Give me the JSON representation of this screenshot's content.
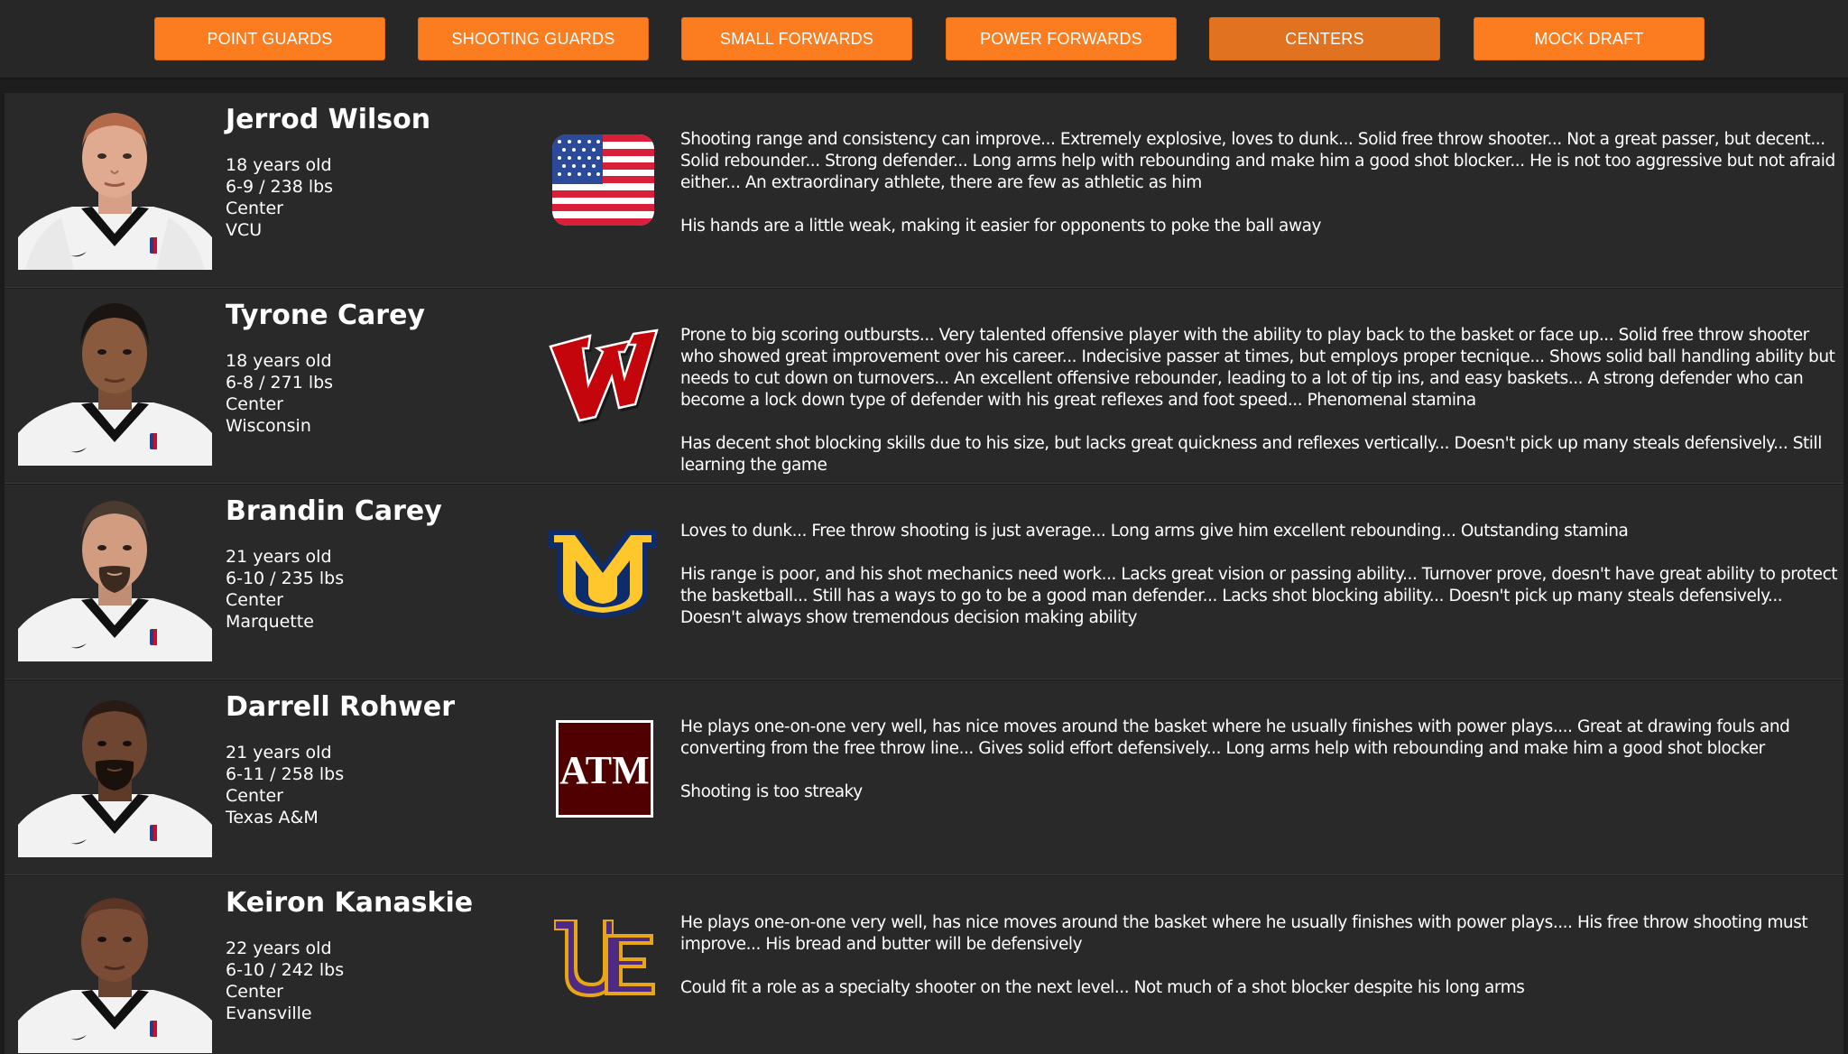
{
  "nav": {
    "buttons": [
      {
        "label": "POINT GUARDS"
      },
      {
        "label": "SHOOTING GUARDS"
      },
      {
        "label": "SMALL FORWARDS"
      },
      {
        "label": "POWER FORWARDS"
      },
      {
        "label": "CENTERS",
        "active": true
      },
      {
        "label": "MOCK DRAFT"
      }
    ],
    "button_color": "#fb7d1f",
    "active_button_color": "#e07220"
  },
  "players": [
    {
      "name": "Jerrod Wilson",
      "age": "18 years old",
      "size": "6-9 / 238 lbs",
      "position": "Center",
      "school": "VCU",
      "logo": "usa-flag-icon",
      "strengths": "Shooting range and consistency can improve... Extremely explosive, loves to dunk... Solid free throw shooter... Not a great passer, but decent... Solid rebounder... Strong defender... Long arms help with rebounding and make him a good shot blocker... He is not too aggressive but not afraid either... An extraordinary athlete, there are few as athletic as him",
      "weaknesses": "His hands are a little weak, making it easier for opponents to poke the ball away"
    },
    {
      "name": "Tyrone Carey",
      "age": "18 years old",
      "size": "6-8 / 271 lbs",
      "position": "Center",
      "school": "Wisconsin",
      "logo": "wisconsin-w-logo-icon",
      "strengths": "Prone to big scoring outbursts... Very talented offensive player with the ability to play back to the basket or face up... Solid free throw shooter who showed great improvement over his career... Indecisive passer at times, but employs proper tecnique... Shows solid ball handling ability but needs to cut down on turnovers... An excellent offensive rebounder, leading to a lot of tip ins, and easy baskets... A strong defender who can become a lock down type of defender with his great reflexes and foot speed... Phenomenal stamina",
      "weaknesses": "Has decent shot blocking skills due to his size, but lacks great quickness and reflexes vertically... Doesn't pick up many steals defensively... Still learning the game"
    },
    {
      "name": "Brandin Carey",
      "age": "21 years old",
      "size": "6-10 / 235 lbs",
      "position": "Center",
      "school": "Marquette",
      "logo": "marquette-mu-logo-icon",
      "strengths": "Loves to dunk... Free throw shooting is just average... Long arms give him excellent rebounding... Outstanding stamina",
      "weaknesses": "His range is poor, and his shot mechanics need work... Lacks great vision or passing ability... Turnover prove, doesn't have great ability to protect the basketball... Still has a ways to go to be a good man defender... Lacks shot blocking ability... Doesn't pick up many steals defensively... Doesn't always show tremendous decision making ability"
    },
    {
      "name": "Darrell Rohwer",
      "age": "21 years old",
      "size": "6-11 / 258 lbs",
      "position": "Center",
      "school": "Texas A&M",
      "logo": "texas-am-logo-icon",
      "logo_text": "ATM",
      "strengths": "He plays one-on-one very well, has nice moves around the basket where he usually finishes with power plays.... Great at drawing fouls and converting from the free throw line... Gives solid effort defensively... Long arms help with rebounding and make him a good shot blocker",
      "weaknesses": "Shooting is too streaky"
    },
    {
      "name": "Keiron Kanaskie",
      "age": "22 years old",
      "size": "6-10 / 242 lbs",
      "position": "Center",
      "school": "Evansville",
      "logo": "evansville-ue-logo-icon",
      "strengths": "He plays one-on-one very well, has nice moves around the basket where he usually finishes with power plays.... His free throw shooting must improve... His bread and butter will be defensively",
      "weaknesses": "Could fit a role as a specialty shooter on the next level... Not much of a shot blocker despite his long arms"
    }
  ]
}
